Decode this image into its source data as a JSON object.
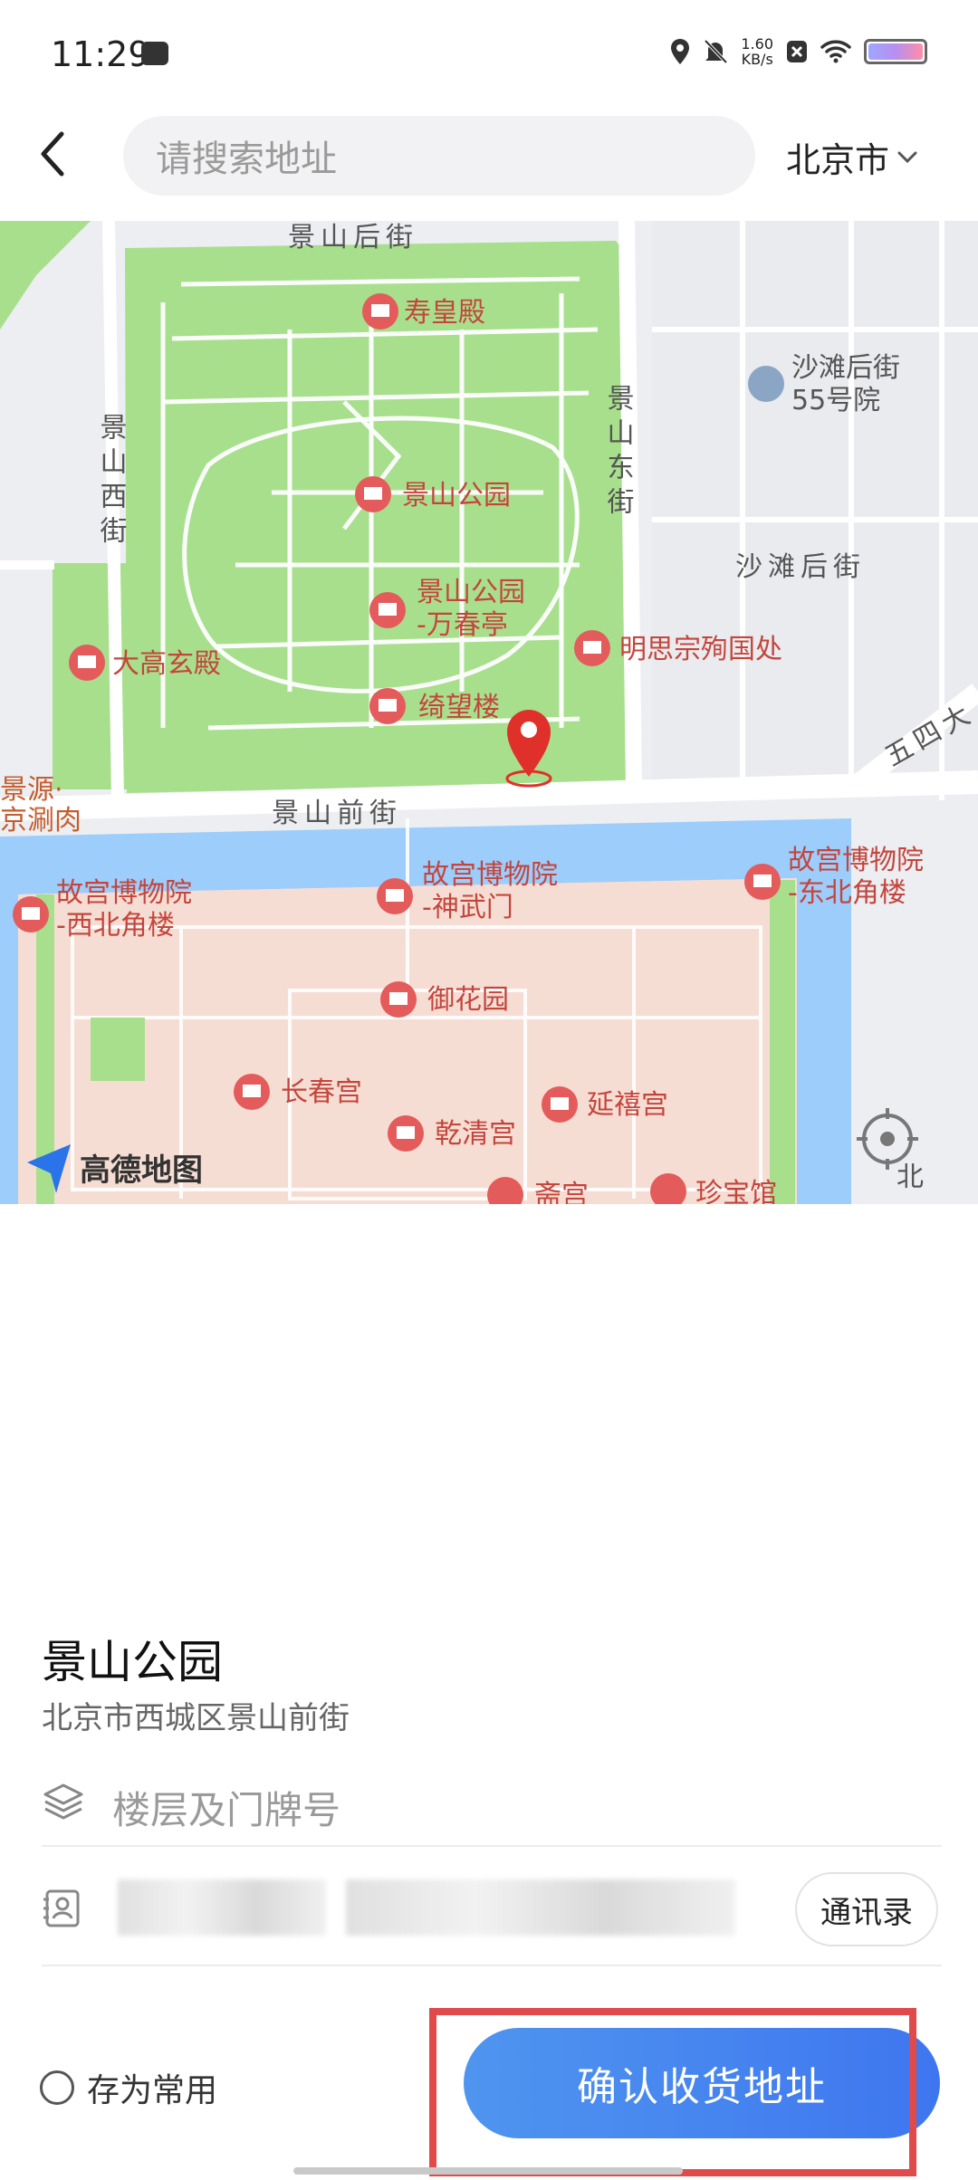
{
  "status": {
    "time": "11:29",
    "net_speed_value": "1.60",
    "net_speed_unit": "KB/s"
  },
  "header": {
    "search_placeholder": "请搜索地址",
    "city": "北京市"
  },
  "map": {
    "brand": "高德地图",
    "streets": {
      "jingshan_hou": "景山后街",
      "jingshan_xi": "景山西街",
      "jingshan_dong": "景山东街",
      "shatan_hou": "沙滩后街",
      "jingshan_qian": "景山前街",
      "wusi": "五四大",
      "jingyuan1": "景源·",
      "jingyuan2": "京涮肉",
      "north": "北"
    },
    "pois": [
      {
        "id": "shouhuang",
        "name": "寿皇殿"
      },
      {
        "id": "shatan55a",
        "name": "沙滩后街"
      },
      {
        "id": "shatan55b",
        "name": "55号院"
      },
      {
        "id": "jingshan",
        "name": "景山公园"
      },
      {
        "id": "wanchun1",
        "name": "景山公园"
      },
      {
        "id": "wanchun2",
        "name": "-万春亭"
      },
      {
        "id": "chongzhen",
        "name": "明思宗殉国处"
      },
      {
        "id": "dagao",
        "name": "大高玄殿"
      },
      {
        "id": "yiwang",
        "name": "绮望楼"
      },
      {
        "id": "shenwu1",
        "name": "故宫博物院"
      },
      {
        "id": "shenwu2",
        "name": "-神武门"
      },
      {
        "id": "xibei1",
        "name": "故宫博物院"
      },
      {
        "id": "xibei2",
        "name": "-西北角楼"
      },
      {
        "id": "dongbei1",
        "name": "故宫博物院"
      },
      {
        "id": "dongbei2",
        "name": "-东北角楼"
      },
      {
        "id": "yuhua",
        "name": "御花园"
      },
      {
        "id": "changchun",
        "name": "长春宫"
      },
      {
        "id": "yanxi",
        "name": "延禧宫"
      },
      {
        "id": "qianqing",
        "name": "乾清宫"
      },
      {
        "id": "zhaibu",
        "name": "斋宫"
      },
      {
        "id": "zhenbao",
        "name": "珍宝馆"
      }
    ]
  },
  "address": {
    "name": "景山公园",
    "detail": "北京市西城区景山前街",
    "floor_placeholder": "楼层及门牌号",
    "contacts_button": "通讯录"
  },
  "footer": {
    "save_label": "存为常用",
    "confirm_button": "确认收货地址"
  },
  "colors": {
    "accent": "#3e76ef",
    "park": "#a8df8d",
    "palace": "#f6ddd3",
    "water": "#9dcdfb",
    "poi": "#e45b5b",
    "highlight": "#e04a4a"
  }
}
